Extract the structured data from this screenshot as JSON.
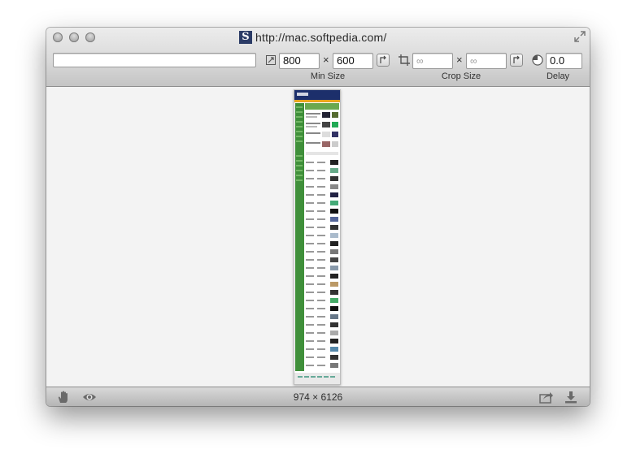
{
  "window": {
    "title": "http://mac.softpedia.com/",
    "site_icon_letter": "S"
  },
  "toolbar": {
    "url_value": "",
    "min_size": {
      "width": "800",
      "height": "600",
      "times": "×",
      "label": "Min Size"
    },
    "crop_size": {
      "width_placeholder": "∞",
      "height_placeholder": "∞",
      "times": "×",
      "label": "Crop Size"
    },
    "delay": {
      "value": "0.0",
      "label": "Delay"
    }
  },
  "preview": {
    "site_name": "softpedia"
  },
  "status": {
    "dimensions": "974 × 6126"
  },
  "icons": {
    "window_controls": [
      "close-icon",
      "minimize-icon",
      "zoom-icon"
    ],
    "fullscreen": "fullscreen-icon",
    "min_size": "resize-icon",
    "crop": "crop-icon",
    "delay": "clock-icon",
    "status_left": [
      "hand-icon",
      "eye-icon"
    ],
    "status_right": [
      "share-icon",
      "download-icon"
    ]
  },
  "colors": {
    "site_green": "#3f8f3a",
    "site_navy": "#1c2f6b"
  }
}
